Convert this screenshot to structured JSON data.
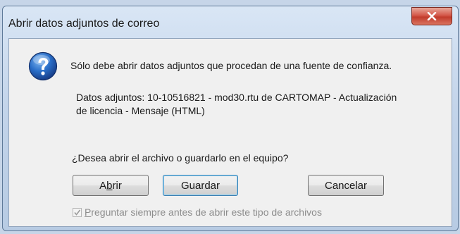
{
  "window": {
    "title": "Abrir datos adjuntos de correo",
    "close_label": "X"
  },
  "message": {
    "warning": "Sólo debe abrir datos adjuntos que procedan de una fuente de confianza.",
    "attachment_line1": "Datos adjuntos: 10-10516821 - mod30.rtu de CARTOMAP - Actualización",
    "attachment_line2": "de licencia - Mensaje (HTML)",
    "question": "¿Desea abrir el archivo o guardarlo en el equipo?"
  },
  "buttons": {
    "open": {
      "pre": "A",
      "accel": "b",
      "post": "rir"
    },
    "save": {
      "label": "Guardar"
    },
    "cancel": {
      "label": "Cancelar"
    }
  },
  "checkbox": {
    "checked": true,
    "enabled": false,
    "accel": "P",
    "label_rest": "reguntar siempre antes de abrir este tipo de archivos"
  },
  "icons": {
    "dialog": "question-icon",
    "close": "close-icon",
    "check": "check-icon"
  },
  "colors": {
    "close_button": "#c23b2c",
    "default_button_border": "#3c7fb1"
  }
}
